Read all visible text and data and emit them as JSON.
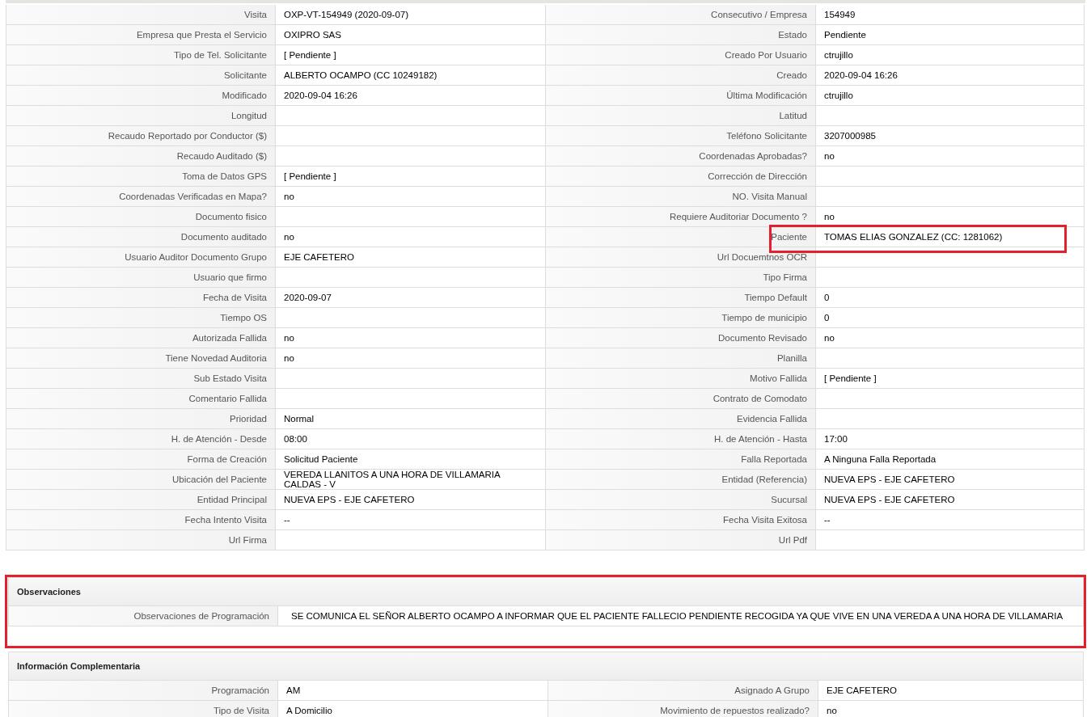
{
  "details": {
    "rows": [
      {
        "fields": [
          {
            "label": "Visita",
            "value": "OXP-VT-154949 (2020-09-07)"
          },
          {
            "label": "Consecutivo / Empresa",
            "value": "154949"
          }
        ]
      },
      {
        "fields": [
          {
            "label": "Empresa que Presta el Servicio",
            "value": "OXIPRO SAS"
          },
          {
            "label": "Estado",
            "value": "Pendiente"
          }
        ]
      },
      {
        "fields": [
          {
            "label": "Tipo de Tel. Solicitante",
            "value": "[ Pendiente ]"
          },
          {
            "label": "Creado Por Usuario",
            "value": "ctrujillo"
          }
        ]
      },
      {
        "fields": [
          {
            "label": "Solicitante",
            "value": "ALBERTO OCAMPO (CC 10249182)"
          },
          {
            "label": "Creado",
            "value": "2020-09-04 16:26"
          }
        ]
      },
      {
        "fields": [
          {
            "label": "Modificado",
            "value": "2020-09-04 16:26"
          },
          {
            "label": "Última Modificación",
            "value": "ctrujillo"
          }
        ]
      },
      {
        "fields": [
          {
            "label": "Longitud"
          },
          {
            "label": "Latitud"
          }
        ]
      },
      {
        "fields": [
          {
            "label": "Recaudo Reportado por Conductor ($)"
          },
          {
            "label": "Teléfono Solicitante",
            "value": "3207000985"
          }
        ]
      },
      {
        "fields": [
          {
            "label": "Recaudo Auditado ($)"
          },
          {
            "label": "Coordenadas Aprobadas?",
            "value": "no"
          }
        ]
      },
      {
        "fields": [
          {
            "label": "Toma de Datos GPS",
            "value": "[ Pendiente ]"
          },
          {
            "label": "Corrección de Dirección"
          }
        ]
      },
      {
        "fields": [
          {
            "label": "Coordenadas Verificadas en Mapa?",
            "value": "no"
          },
          {
            "label": "NO. Visita Manual"
          }
        ]
      },
      {
        "fields": [
          {
            "label": "Documento fisico"
          },
          {
            "label": "Requiere Auditoriar Documento ?",
            "value": "no"
          }
        ]
      },
      {
        "fields": [
          {
            "label": "Documento auditado",
            "value": "no"
          },
          {
            "label": "Paciente",
            "value": "TOMAS ELIAS GONZALEZ (CC: 1281062)",
            "highlighted": true
          }
        ]
      },
      {
        "fields": [
          {
            "label": "Usuario Auditor Documento Grupo",
            "value": "EJE CAFETERO"
          },
          {
            "label": "Url Docuemtnos OCR"
          }
        ]
      },
      {
        "fields": [
          {
            "label": "Usuario que firmo"
          },
          {
            "label": "Tipo Firma"
          }
        ]
      },
      {
        "fields": [
          {
            "label": "Fecha de Visita",
            "value": "2020-09-07"
          },
          {
            "label": "Tiempo Default",
            "value": "0"
          }
        ]
      },
      {
        "fields": [
          {
            "label": "Tiempo OS"
          },
          {
            "label": "Tiempo de municipio",
            "value": "0"
          }
        ]
      },
      {
        "fields": [
          {
            "label": "Autorizada Fallida",
            "value": "no"
          },
          {
            "label": "Documento Revisado",
            "value": "no"
          }
        ]
      },
      {
        "fields": [
          {
            "label": "Tiene Novedad Auditoria",
            "value": "no"
          },
          {
            "label": "Planilla"
          }
        ]
      },
      {
        "fields": [
          {
            "label": "Sub Estado Visita"
          },
          {
            "label": "Motivo Fallida",
            "value": "[ Pendiente ]"
          }
        ]
      },
      {
        "fields": [
          {
            "label": "Comentario Fallida"
          },
          {
            "label": "Contrato de Comodato"
          }
        ]
      },
      {
        "fields": [
          {
            "label": "Prioridad",
            "value": "Normal"
          },
          {
            "label": "Evidencia Fallida"
          }
        ]
      },
      {
        "fields": [
          {
            "label": "H. de Atención - Desde",
            "value": "08:00"
          },
          {
            "label": "H. de Atención - Hasta",
            "value": "17:00"
          }
        ]
      },
      {
        "fields": [
          {
            "label": "Forma de Creación",
            "value": "Solicitud Paciente"
          },
          {
            "label": "Falla Reportada",
            "value": "A Ninguna Falla Reportada"
          }
        ]
      },
      {
        "fields": [
          {
            "label": "Ubicación del Paciente",
            "value": "VEREDA LLANITOS A UNA HORA DE VILLAMARIA CALDAS - V"
          },
          {
            "label": "Entidad (Referencia)",
            "value": "NUEVA EPS - EJE CAFETERO"
          }
        ]
      },
      {
        "fields": [
          {
            "label": "Entidad Principal",
            "value": "NUEVA EPS - EJE CAFETERO"
          },
          {
            "label": "Sucursal",
            "value": "NUEVA EPS - EJE CAFETERO"
          }
        ]
      },
      {
        "fields": [
          {
            "label": "Fecha Intento Visita",
            "value": "--"
          },
          {
            "label": "Fecha Visita Exitosa",
            "value": "--"
          }
        ]
      },
      {
        "fields": [
          {
            "label": "Url Firma"
          },
          {
            "label": "Url Pdf"
          }
        ]
      }
    ]
  },
  "sections": [
    {
      "title": "Observaciones",
      "highlighted": true,
      "rows": [
        {
          "fields": [
            {
              "label": "Observaciones de Programación",
              "value": "SE COMUNICA EL SEÑOR ALBERTO OCAMPO A INFORMAR QUE EL PACIENTE FALLECIO PENDIENTE RECOGIDA YA QUE VIVE EN UNA VEREDA A UNA HORA DE VILLAMARIA"
            }
          ]
        }
      ]
    },
    {
      "title": "Información Complementaria",
      "highlighted": false,
      "rows": [
        {
          "fields": [
            {
              "label": "Programación",
              "value": "AM"
            },
            {
              "label": "Asignado A Grupo",
              "value": "EJE CAFETERO"
            }
          ]
        },
        {
          "fields": [
            {
              "label": "Tipo de Visita",
              "value": "A Domicilio"
            },
            {
              "label": "Movimiento de repuestos realizado?",
              "value": "no"
            }
          ]
        }
      ]
    }
  ]
}
